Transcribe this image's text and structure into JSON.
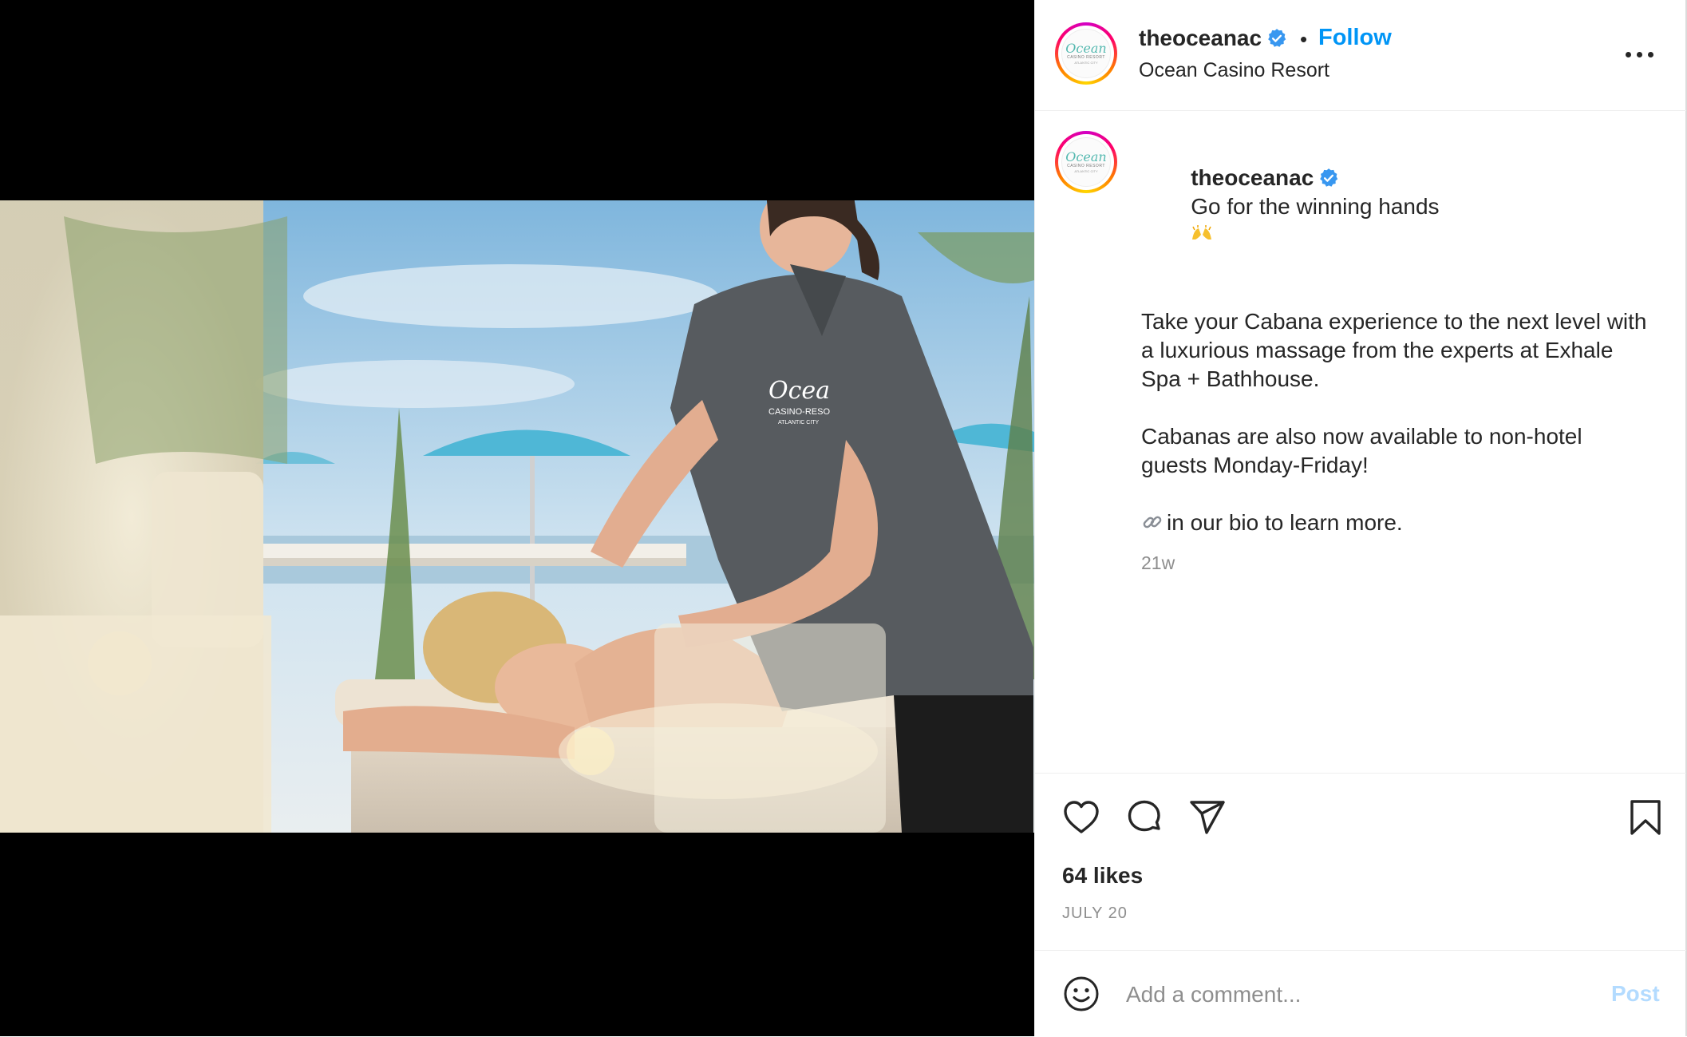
{
  "post": {
    "username": "theoceanac",
    "follow_label": "Follow",
    "separator": "•",
    "location": "Ocean Casino Resort",
    "avatar_logo": {
      "line1": "Ocean",
      "line2": "CASINO RESORT",
      "line3": "ATLANTIC CITY"
    },
    "caption": {
      "username": "theoceanac",
      "first_line": "Go for the winning hands",
      "first_line_emoji": "raising-hands-emoji",
      "para1": "Take your Cabana experience to the next level with a luxurious massage from the experts at Exhale Spa + Bathhouse.",
      "para2": "Cabanas are also now available to non-hotel guests Monday-Friday!",
      "para3": "in our bio to learn more.",
      "para3_icon": "link-icon",
      "time_ago": "21w"
    },
    "photo": {
      "shirt_logo_line1": "Ocea",
      "shirt_logo_line2": "CASINO-RESO",
      "shirt_logo_line3": "ATLANTIC CITY"
    },
    "likes": "64 likes",
    "date": "JULY 20",
    "comment": {
      "placeholder": "Add a comment...",
      "post_label": "Post"
    }
  },
  "colors": {
    "accent": "#0095f6",
    "post_disabled": "#b3dbff",
    "verified": "#3897f0",
    "muted": "#8e8e8e"
  },
  "icons": [
    "heart-icon",
    "comment-icon",
    "share-icon",
    "bookmark-icon",
    "emoji-icon",
    "more-options-icon",
    "verified-badge-icon"
  ]
}
